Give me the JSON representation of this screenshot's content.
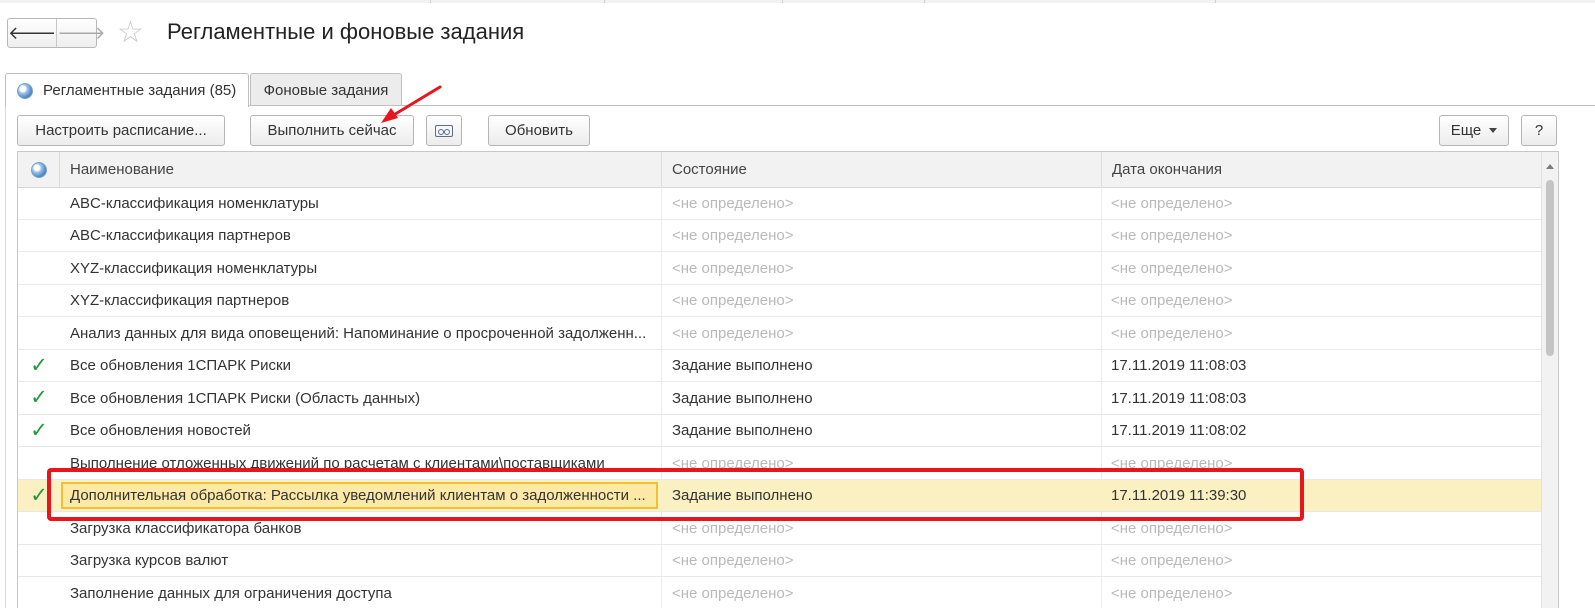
{
  "nav": {
    "back_icon": "arrow-left-icon",
    "forward_icon": "arrow-right-icon",
    "favorite_icon": "star-outline-icon"
  },
  "header": {
    "title": "Регламентные и фоновые задания"
  },
  "tabs": [
    {
      "label": "Регламентные задания (85)",
      "active": true,
      "icon": "globe-icon"
    },
    {
      "label": "Фоновые задания",
      "active": false
    }
  ],
  "toolbar": {
    "schedule_label": "Настроить расписание...",
    "run_now_label": "Выполнить сейчас",
    "cassette_icon": "cassette-icon",
    "refresh_label": "Обновить",
    "more_label": "Еще",
    "help_label": "?"
  },
  "grid": {
    "columns": {
      "icon": "globe-icon",
      "name": "Наименование",
      "state": "Состояние",
      "end_date": "Дата окончания"
    },
    "rows": [
      {
        "name": "ABC-классификация номенклатуры",
        "state": "<не определено>",
        "end_date": "<не определено>",
        "done": false,
        "selected": false
      },
      {
        "name": "ABC-классификация партнеров",
        "state": "<не определено>",
        "end_date": "<не определено>",
        "done": false,
        "selected": false
      },
      {
        "name": "XYZ-классификация номенклатуры",
        "state": "<не определено>",
        "end_date": "<не определено>",
        "done": false,
        "selected": false
      },
      {
        "name": "XYZ-классификация партнеров",
        "state": "<не определено>",
        "end_date": "<не определено>",
        "done": false,
        "selected": false
      },
      {
        "name": "Анализ данных для вида оповещений: Напоминание о просроченной задолженн...",
        "state": "<не определено>",
        "end_date": "<не определено>",
        "done": false,
        "selected": false
      },
      {
        "name": "Все обновления 1СПАРК Риски",
        "state": "Задание выполнено",
        "end_date": "17.11.2019 11:08:03",
        "done": true,
        "selected": false
      },
      {
        "name": "Все обновления 1СПАРК Риски (Область данных)",
        "state": "Задание выполнено",
        "end_date": "17.11.2019 11:08:03",
        "done": true,
        "selected": false
      },
      {
        "name": "Все обновления новостей",
        "state": "Задание выполнено",
        "end_date": "17.11.2019 11:08:02",
        "done": true,
        "selected": false
      },
      {
        "name": "Выполнение отложенных движений по расчетам с клиентами\\поставщиками",
        "state": "<не определено>",
        "end_date": "<не определено>",
        "done": false,
        "selected": false
      },
      {
        "name": "Дополнительная обработка: Рассылка уведомлений клиентам о задолженности ...",
        "state": "Задание выполнено",
        "end_date": "17.11.2019 11:39:30",
        "done": true,
        "selected": true
      },
      {
        "name": "Загрузка классификатора банков",
        "state": "<не определено>",
        "end_date": "<не определено>",
        "done": false,
        "selected": false
      },
      {
        "name": "Загрузка курсов валют",
        "state": "<не определено>",
        "end_date": "<не определено>",
        "done": false,
        "selected": false
      },
      {
        "name": "Заполнение данных для ограничения доступа",
        "state": "<не определено>",
        "end_date": "<не определено>",
        "done": false,
        "selected": false
      }
    ]
  },
  "colors": {
    "annotation": "#e8161b",
    "selected_row": "#fbf0c2",
    "focus_border": "#f2c12e",
    "check": "#1e9a3c"
  }
}
